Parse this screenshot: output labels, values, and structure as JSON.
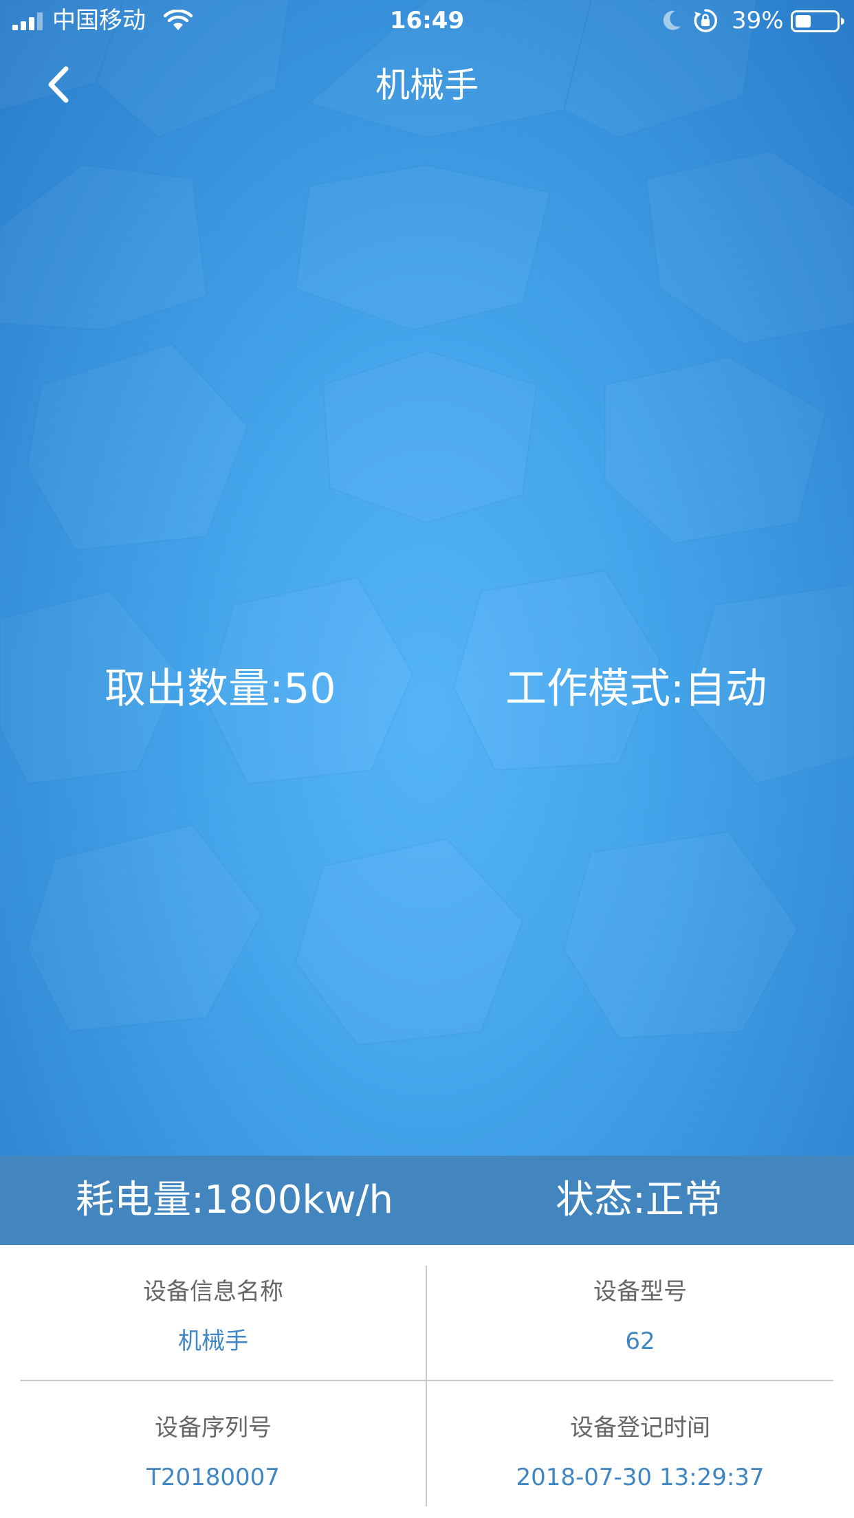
{
  "status_bar": {
    "carrier": "中国移动",
    "time": "16:49",
    "battery_percent": "39%"
  },
  "nav": {
    "title": "机械手",
    "back_icon": "chevron-left-icon"
  },
  "hero": {
    "take_out_count": "取出数量:50",
    "work_mode": "工作模式:自动"
  },
  "strip": {
    "power_consumption": "耗电量:1800kw/h",
    "status": "状态:正常"
  },
  "info": {
    "device_name_label": "设备信息名称",
    "device_name_value": "机械手",
    "device_model_label": "设备型号",
    "device_model_value": "62",
    "serial_label": "设备序列号",
    "serial_value": "T20180007",
    "register_time_label": "设备登记时间",
    "register_time_value": "2018-07-30 13:29:37"
  },
  "colors": {
    "hero_blue": "#45a6ec",
    "strip_blue": "#4386bf",
    "value_blue": "#3f86c3",
    "label_gray": "#666666",
    "divider_gray": "#c8c8c8"
  }
}
